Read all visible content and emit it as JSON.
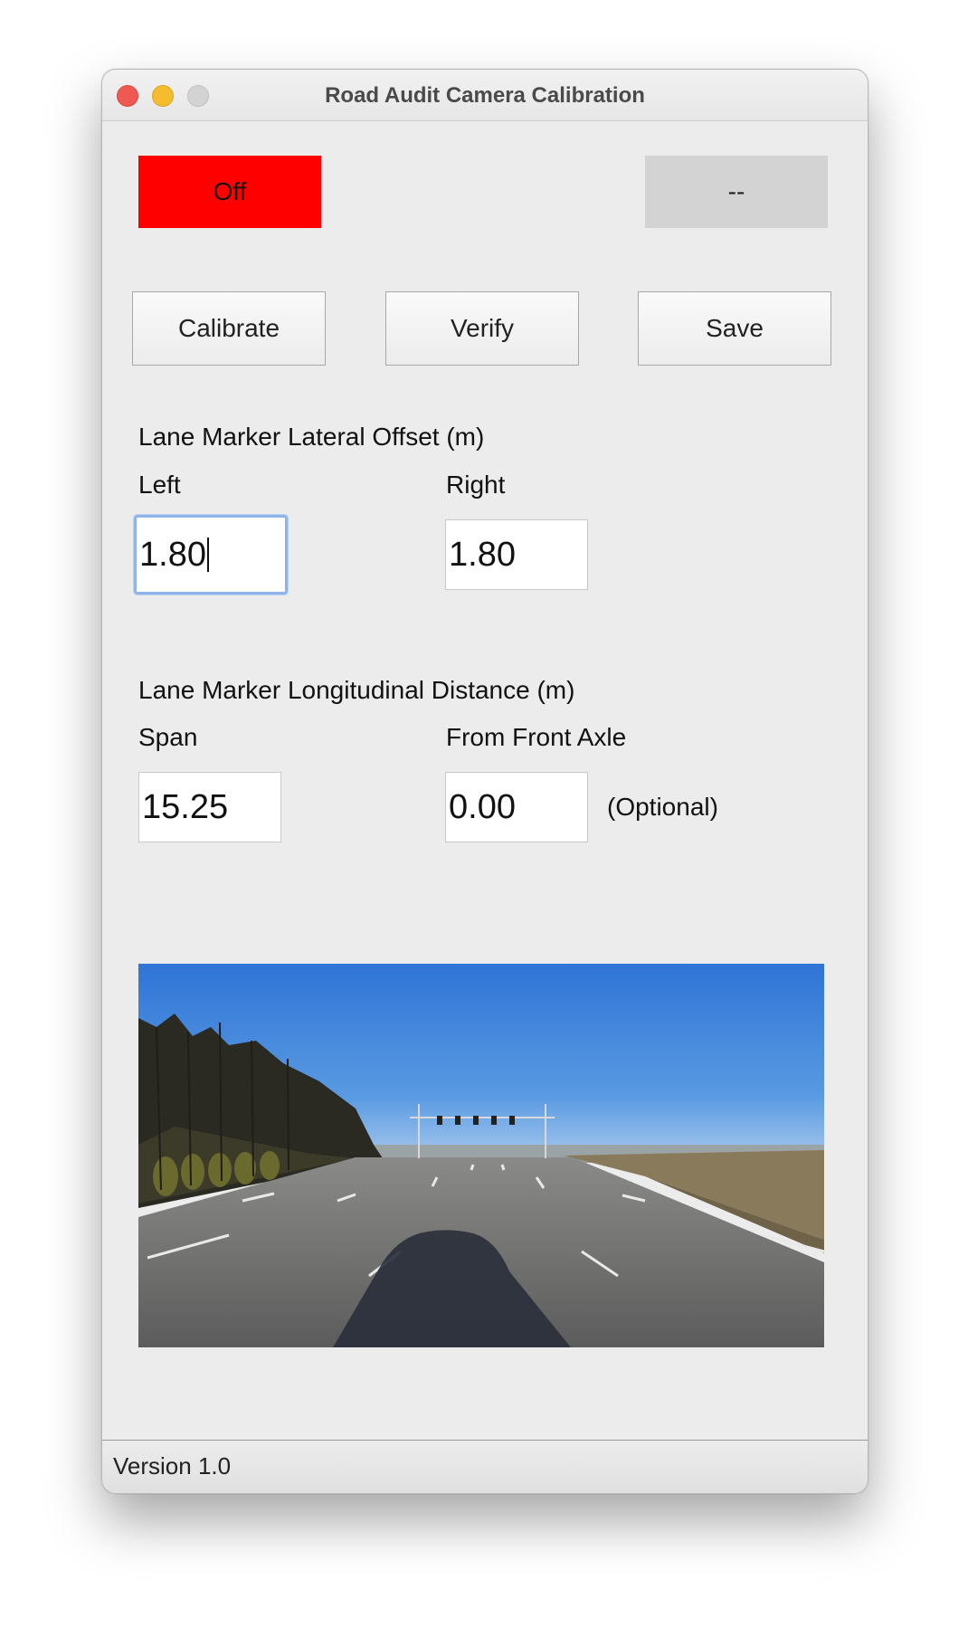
{
  "window": {
    "title": "Road Audit Camera Calibration"
  },
  "status": {
    "left_label": "Off",
    "left_color": "#ff0000",
    "right_label": "--",
    "right_color": "#d3d3d3"
  },
  "toolbar": {
    "calibrate_label": "Calibrate",
    "verify_label": "Verify",
    "save_label": "Save"
  },
  "lateral": {
    "heading": "Lane Marker Lateral Offset (m)",
    "left_label": "Left",
    "left_value": "1.80",
    "right_label": "Right",
    "right_value": "1.80"
  },
  "longitudinal": {
    "heading": "Lane Marker Longitudinal Distance (m)",
    "span_label": "Span",
    "span_value": "15.25",
    "front_axle_label": "From Front Axle",
    "front_axle_value": "0.00",
    "optional_note": "(Optional)"
  },
  "camera_view": {
    "sky_color": "#3f82dc",
    "road_color": "#6b6b6b"
  },
  "footer": {
    "version": "Version 1.0"
  }
}
